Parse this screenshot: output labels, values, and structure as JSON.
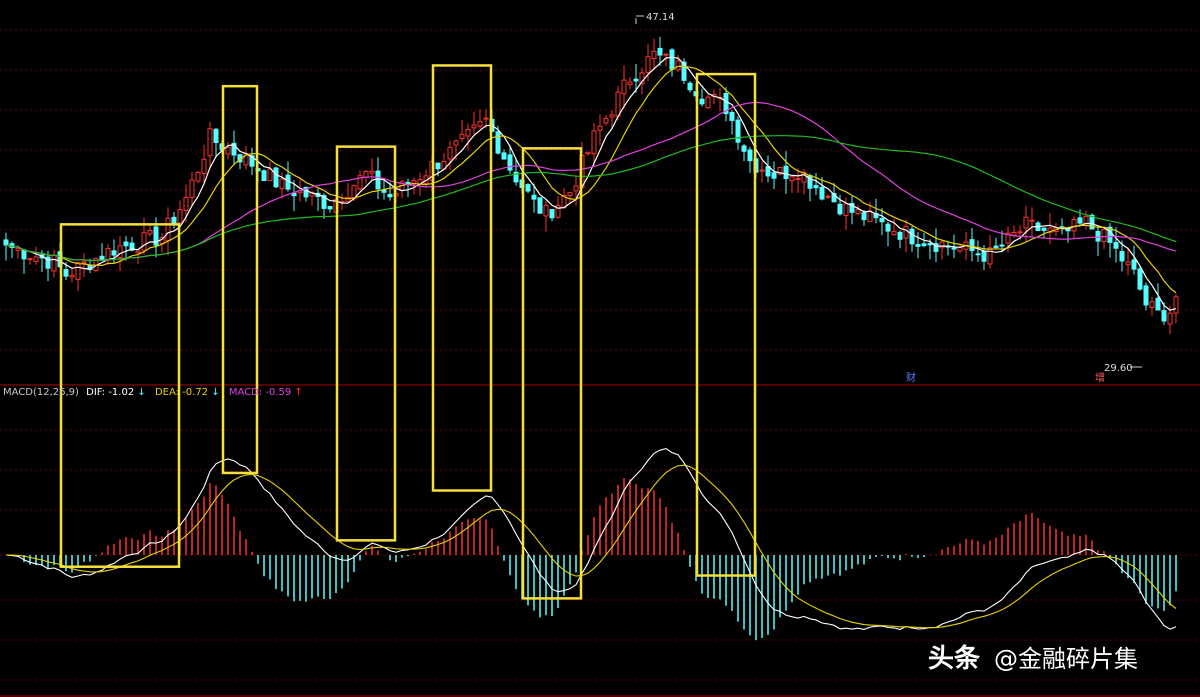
{
  "chart_data": [
    {
      "type": "candlestick",
      "panel": "price",
      "title": "",
      "price_range": [
        26.5,
        48.5
      ],
      "ma_periods": [
        5,
        10,
        30,
        60
      ],
      "ma_colors": [
        "#ffffff",
        "#e6d200",
        "#e040e0",
        "#1fb81f"
      ],
      "up_color": "#ff3030",
      "down_color": "#54ffff",
      "annotations": {
        "high_label": "47.14",
        "high_value": 47.14,
        "low_label": "29.60",
        "low_value": 29.6,
        "event_marker_1": "财",
        "event_marker_2": "增"
      },
      "waypoints": [
        [
          0,
          34.6
        ],
        [
          8,
          33.6
        ],
        [
          10,
          32.9
        ],
        [
          18,
          34.4
        ],
        [
          26,
          35.1
        ],
        [
          30,
          37.3
        ],
        [
          34,
          40.8
        ],
        [
          40,
          39.6
        ],
        [
          46,
          38.0
        ],
        [
          54,
          37.0
        ],
        [
          60,
          38.7
        ],
        [
          64,
          37.4
        ],
        [
          70,
          38.9
        ],
        [
          76,
          40.5
        ],
        [
          80,
          41.8
        ],
        [
          84,
          39.1
        ],
        [
          88,
          37.0
        ],
        [
          90,
          36.4
        ],
        [
          94,
          37.7
        ],
        [
          98,
          40.8
        ],
        [
          104,
          44.3
        ],
        [
          108,
          45.6
        ],
        [
          112,
          44.9
        ],
        [
          116,
          43.3
        ],
        [
          120,
          42.6
        ],
        [
          124,
          39.5
        ],
        [
          128,
          38.7
        ],
        [
          132,
          39.0
        ],
        [
          136,
          37.7
        ],
        [
          140,
          36.7
        ],
        [
          146,
          35.8
        ],
        [
          152,
          35.0
        ],
        [
          158,
          34.5
        ],
        [
          164,
          34.0
        ],
        [
          170,
          35.7
        ],
        [
          176,
          35.2
        ],
        [
          180,
          35.9
        ],
        [
          184,
          34.7
        ],
        [
          188,
          32.9
        ],
        [
          190,
          31.2
        ],
        [
          192,
          30.6
        ],
        [
          194,
          30.8
        ],
        [
          195,
          31.6
        ]
      ]
    },
    {
      "type": "macd",
      "panel": "indicator",
      "legend": {
        "name": "MACD(12,26,9)",
        "dif_label": "DIF: -1.02",
        "dif_arrow": "↓",
        "dea_label": "DEA: -0.72",
        "dea_arrow": "↓",
        "macd_label": "MACD: -0.59",
        "macd_arrow": "↑"
      },
      "value_range": [
        -2.9,
        2.9
      ],
      "colors": {
        "dif": "#ffffff",
        "dea": "#e6d200",
        "hist_pos": "#ff3030",
        "hist_neg": "#54ffff"
      }
    }
  ],
  "highlight_boxes": {
    "color": "#f5e03a",
    "boxes": [
      {
        "bar_start": 10,
        "bar_end": 28,
        "value_top": 35.8,
        "value_bottom": -0.2
      },
      {
        "bar_start": 37,
        "bar_end": 41,
        "value_top": 43.8,
        "value_bottom": 1.4
      },
      {
        "bar_start": 56,
        "bar_end": 64,
        "value_top": 40.3,
        "value_bottom": 0.25
      },
      {
        "bar_start": 72,
        "bar_end": 80,
        "value_top": 45.0,
        "value_bottom": 1.1
      },
      {
        "bar_start": 87,
        "bar_end": 95,
        "value_top": 40.2,
        "value_bottom": -0.74
      },
      {
        "bar_start": 116,
        "bar_end": 124,
        "value_top": 44.5,
        "value_bottom": -0.35
      }
    ]
  },
  "watermark": {
    "brand": "头条",
    "handle": "@金融碎片集"
  }
}
